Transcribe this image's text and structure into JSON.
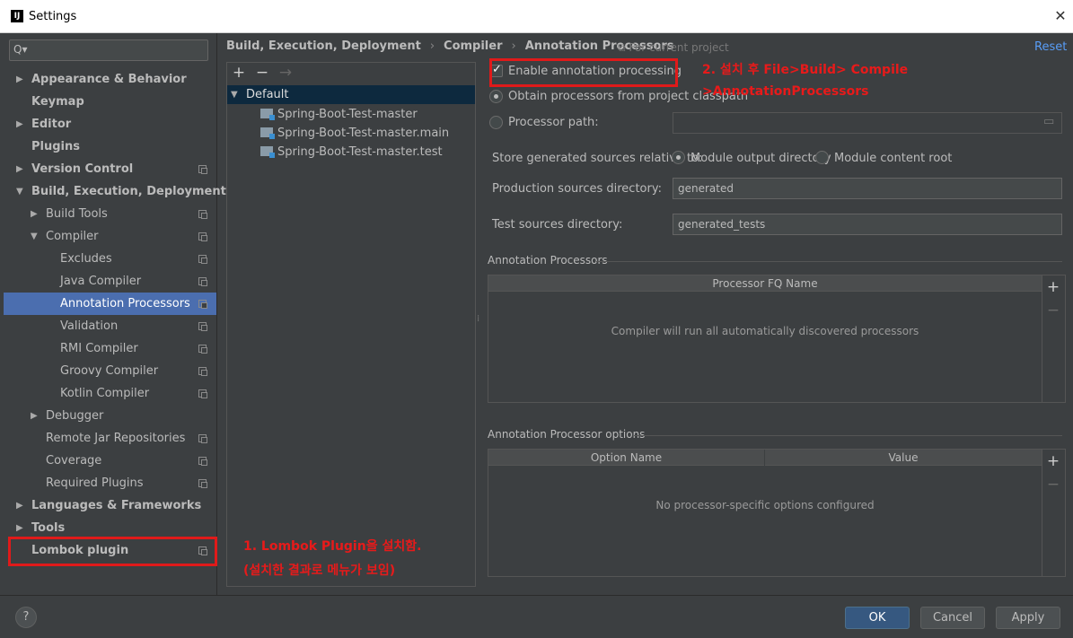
{
  "window": {
    "title": "Settings",
    "logo": "IJ",
    "close_symbol": "✕"
  },
  "search": {
    "icon": "Q▾",
    "placeholder": ""
  },
  "tree": [
    {
      "label": "Appearance & Behavior",
      "bold": true,
      "arrow": "▶",
      "copy": false
    },
    {
      "label": "Keymap",
      "bold": true,
      "arrow": "",
      "copy": false
    },
    {
      "label": "Editor",
      "bold": true,
      "arrow": "▶",
      "copy": false
    },
    {
      "label": "Plugins",
      "bold": true,
      "arrow": "",
      "copy": false
    },
    {
      "label": "Version Control",
      "bold": true,
      "arrow": "▶",
      "copy": true
    },
    {
      "label": "Build, Execution, Deployment",
      "bold": true,
      "arrow": "▼",
      "copy": false
    },
    {
      "label": "Build Tools",
      "bold": false,
      "arrow": "▶",
      "copy": true
    },
    {
      "label": "Compiler",
      "bold": false,
      "arrow": "▼",
      "copy": true
    },
    {
      "label": "Excludes",
      "bold": false,
      "arrow": "",
      "copy": true
    },
    {
      "label": "Java Compiler",
      "bold": false,
      "arrow": "",
      "copy": true
    },
    {
      "label": "Annotation Processors",
      "bold": false,
      "arrow": "",
      "copy": true,
      "selected": true
    },
    {
      "label": "Validation",
      "bold": false,
      "arrow": "",
      "copy": true
    },
    {
      "label": "RMI Compiler",
      "bold": false,
      "arrow": "",
      "copy": true
    },
    {
      "label": "Groovy Compiler",
      "bold": false,
      "arrow": "",
      "copy": true
    },
    {
      "label": "Kotlin Compiler",
      "bold": false,
      "arrow": "",
      "copy": true
    },
    {
      "label": "Debugger",
      "bold": false,
      "arrow": "▶",
      "copy": false
    },
    {
      "label": "Remote Jar Repositories",
      "bold": false,
      "arrow": "",
      "copy": true
    },
    {
      "label": "Coverage",
      "bold": false,
      "arrow": "",
      "copy": true
    },
    {
      "label": "Required Plugins",
      "bold": false,
      "arrow": "",
      "copy": true
    },
    {
      "label": "Languages & Frameworks",
      "bold": true,
      "arrow": "▶",
      "copy": false
    },
    {
      "label": "Tools",
      "bold": true,
      "arrow": "▶",
      "copy": false
    },
    {
      "label": "Lombok plugin",
      "bold": true,
      "arrow": "",
      "copy": true
    }
  ],
  "breadcrumb": {
    "part1": "Build, Execution, Deployment",
    "part2": "Compiler",
    "part3": "Annotation Processors",
    "sep": "›"
  },
  "scope_note": "For current project",
  "reset_label": "Reset",
  "profiles": {
    "add": "+",
    "remove": "−",
    "move": "→",
    "default_label": "Default",
    "modules": [
      "Spring-Boot-Test-master",
      "Spring-Boot-Test-master.main",
      "Spring-Boot-Test-master.test"
    ]
  },
  "form": {
    "enable_label": "Enable annotation processing",
    "enable_checked": true,
    "obtain_label": "Obtain processors from project classpath",
    "processor_path_label": "Processor path:",
    "processor_path_value": "",
    "store_label": "Store generated sources relative to:",
    "module_output_label": "Module output directory",
    "module_content_label": "Module content root",
    "production_label": "Production sources directory:",
    "production_value": "generated",
    "test_label": "Test sources directory:",
    "test_value": "generated_tests"
  },
  "processors_section": {
    "title": "Annotation Processors",
    "column": "Processor FQ Name",
    "empty": "Compiler will run all automatically discovered processors",
    "add": "+",
    "remove": "−"
  },
  "options_section": {
    "title": "Annotation Processor options",
    "col1": "Option Name",
    "col2": "Value",
    "empty": "No processor-specific options configured",
    "add": "+",
    "remove": "−"
  },
  "annotations": {
    "note1_line1": "1. Lombok Plugin을 설치함.",
    "note1_line2": "(설치한 결과로 메뉴가 보임)",
    "note2_line1": "2. 설치 후 File>Build> Compile",
    "note2_line2": ">AnnotationProcessors"
  },
  "footer": {
    "help": "?",
    "ok": "OK",
    "cancel": "Cancel",
    "apply": "Apply"
  },
  "colors": {
    "accent": "#4b6eaf",
    "annotation_red": "#e01a1a",
    "link": "#589df6"
  }
}
